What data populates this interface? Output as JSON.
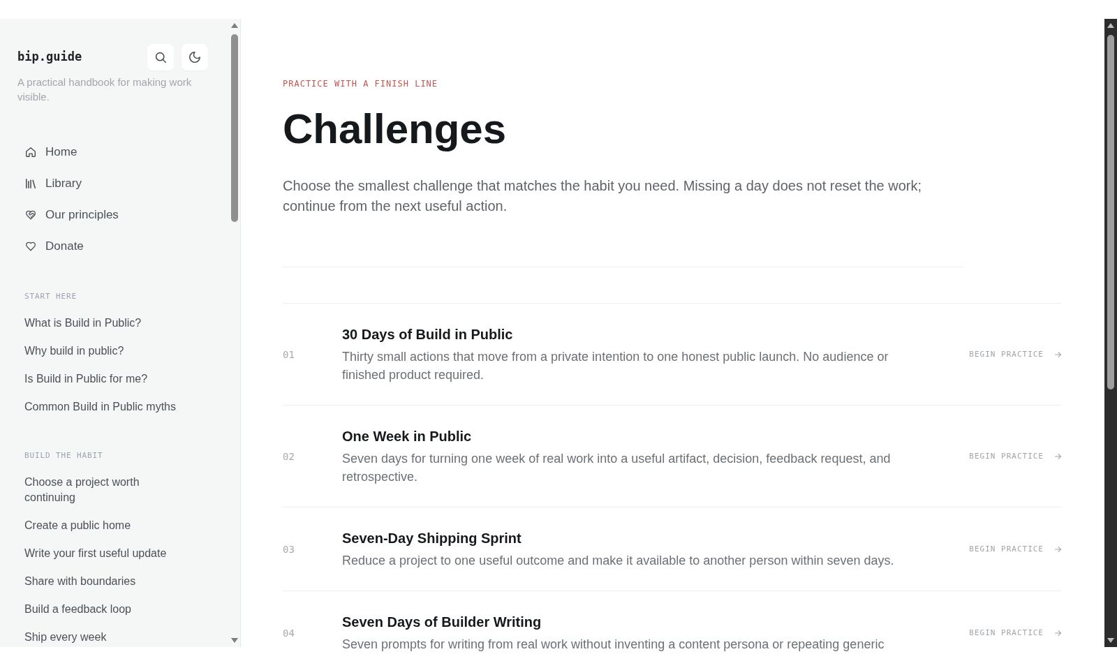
{
  "sidebar": {
    "brand": "bip.guide",
    "tagline": "A practical handbook for making work visible.",
    "nav": [
      {
        "label": "Home"
      },
      {
        "label": "Library"
      },
      {
        "label": "Our principles"
      },
      {
        "label": "Donate"
      }
    ],
    "sections": [
      {
        "heading": "START HERE",
        "links": [
          "What is Build in Public?",
          "Why build in public?",
          "Is Build in Public for me?",
          "Common Build in Public myths"
        ]
      },
      {
        "heading": "BUILD THE HABIT",
        "links": [
          "Choose a project worth continuing",
          "Create a public home",
          "Write your first useful update",
          "Share with boundaries",
          "Build a feedback loop",
          "Ship every week"
        ]
      }
    ]
  },
  "main": {
    "eyebrow": "PRACTICE WITH A FINISH LINE",
    "title": "Challenges",
    "intro": "Choose the smallest challenge that matches the habit you need. Missing a day does not reset the work; continue from the next useful action.",
    "challenges": [
      {
        "number": "01",
        "title": "30 Days of Build in Public",
        "description": "Thirty small actions that move from a private intention to one honest public launch. No audience or finished product required.",
        "action": "BEGIN PRACTICE"
      },
      {
        "number": "02",
        "title": "One Week in Public",
        "description": "Seven days for turning one week of real work into a useful artifact, decision, feedback request, and retrospective.",
        "action": "BEGIN PRACTICE"
      },
      {
        "number": "03",
        "title": "Seven-Day Shipping Sprint",
        "description": "Reduce a project to one useful outcome and make it available to another person within seven days.",
        "action": "BEGIN PRACTICE"
      },
      {
        "number": "04",
        "title": "Seven Days of Builder Writing",
        "description": "Seven prompts for writing from real work without inventing a content persona or repeating generic",
        "action": "BEGIN PRACTICE"
      }
    ]
  }
}
